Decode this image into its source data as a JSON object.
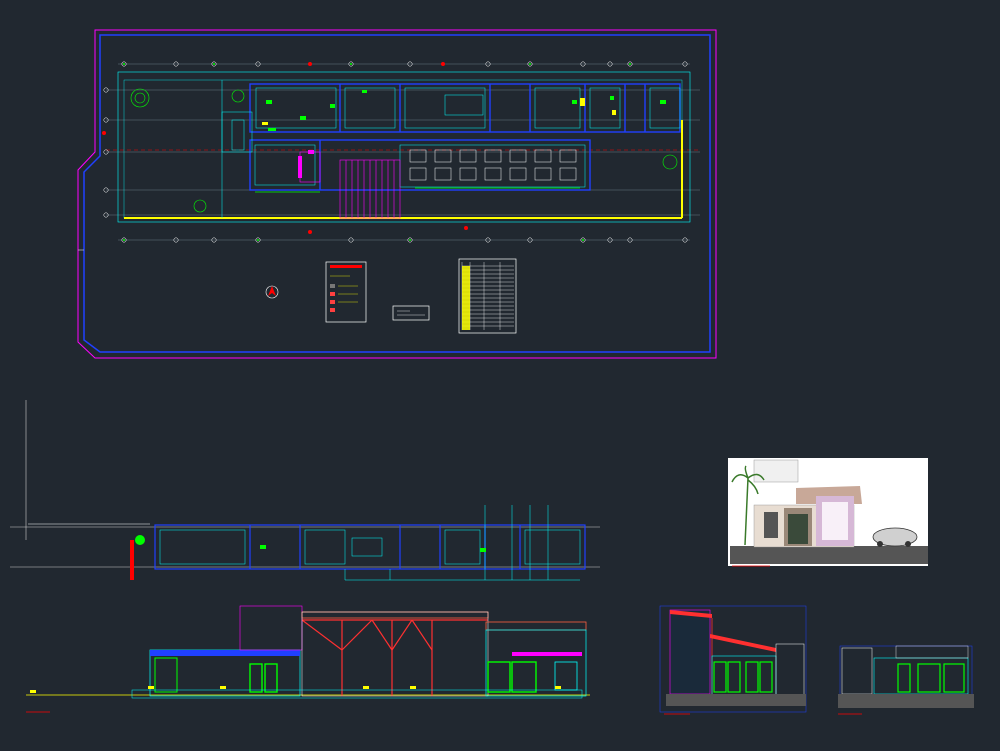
{
  "drawing": {
    "title": "",
    "colors": {
      "background": "#212830",
      "frame": "#ff00ff",
      "frame_inner": "#0000ff",
      "wall": "#00ffff",
      "blue": "#2040ff",
      "yellow": "#ffff00",
      "green": "#00ff00",
      "red": "#ff0000",
      "magenta": "#ff00ff",
      "white": "#ffffff",
      "dim": "#7a8a9a"
    }
  },
  "sheets": [
    {
      "id": "floor-plan",
      "label": ""
    },
    {
      "id": "site-plan",
      "label": ""
    },
    {
      "id": "long-section",
      "label": ""
    },
    {
      "id": "render-3d",
      "label": ""
    },
    {
      "id": "cross-section-a",
      "label": ""
    },
    {
      "id": "cross-section-b",
      "label": ""
    }
  ],
  "legend": {
    "title": "",
    "rows": 5
  },
  "schedule_table": {
    "rows": 20,
    "cols": 4
  },
  "note_box": {
    "lines": 2
  }
}
